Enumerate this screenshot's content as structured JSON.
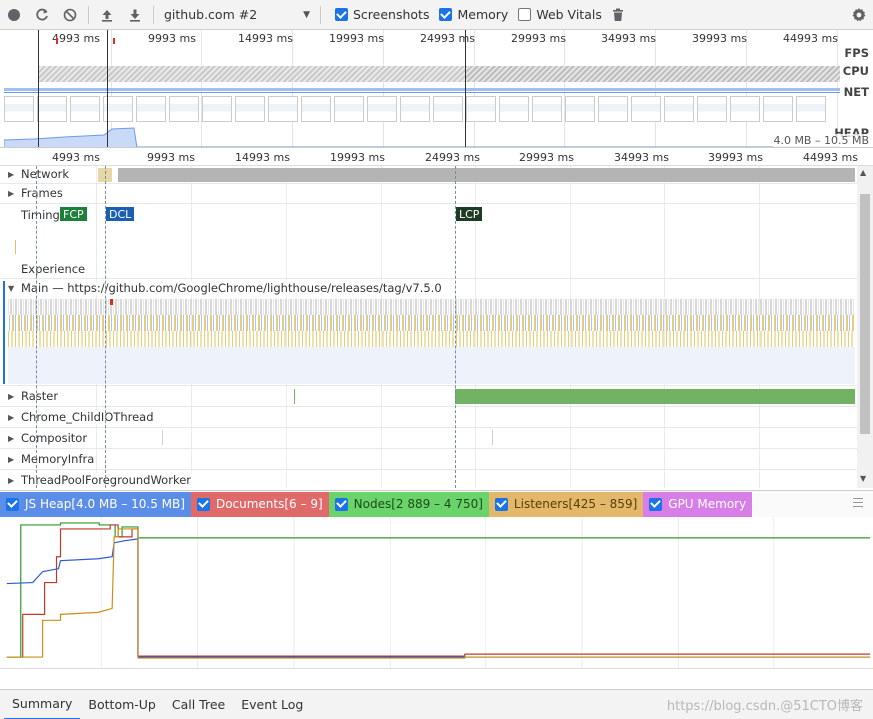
{
  "toolbar": {
    "recording": "github.com #2",
    "screenshots_label": "Screenshots",
    "memory_label": "Memory",
    "webvitals_label": "Web Vitals",
    "screenshots_checked": true,
    "memory_checked": true,
    "webvitals_checked": false
  },
  "overview": {
    "ticks": [
      "4993 ms",
      "9993 ms",
      "14993 ms",
      "19993 ms",
      "24993 ms",
      "29993 ms",
      "34993 ms",
      "39993 ms",
      "44993 ms"
    ],
    "labels": {
      "fps": "FPS",
      "cpu": "CPU",
      "net": "NET",
      "heap": "HEAP"
    },
    "heap_range": "4.0 MB – 10.5 MB"
  },
  "ruler": {
    "ticks": [
      "4993 ms",
      "9993 ms",
      "14993 ms",
      "19993 ms",
      "24993 ms",
      "29993 ms",
      "34993 ms",
      "39993 ms",
      "44993 ms"
    ]
  },
  "tracks": {
    "network": "Network",
    "frames": "Frames",
    "timings": "Timings",
    "experience": "Experience",
    "main": "Main — https://github.com/GoogleChrome/lighthouse/releases/tag/v7.5.0",
    "raster": "Raster",
    "childio": "Chrome_ChildIOThread",
    "compositor": "Compositor",
    "memoryinfra": "MemoryInfra",
    "threadpool": "ThreadPoolForegroundWorker"
  },
  "timings": {
    "fcp": "FCP",
    "dcl": "DCL",
    "lcp": "LCP"
  },
  "colors": {
    "fcp": "#1e7f3a",
    "dcl": "#1a5fb4",
    "lcp": "#1d3b25",
    "raster": "#72b263",
    "js_heap": "#2a5ad8",
    "documents": "#c0392b",
    "nodes": "#2e9a2e",
    "listeners": "#c9901a",
    "gpu": "#a43ac8"
  },
  "counters": [
    {
      "label": "JS Heap[4.0 MB – 10.5 MB]",
      "bg": "#5b8ee8",
      "fg": "#ffffff"
    },
    {
      "label": "Documents[6 – 9]",
      "bg": "#e06a6a",
      "fg": "#ffffff"
    },
    {
      "label": "Nodes[2 889 – 4 750]",
      "bg": "#6ad46a",
      "fg": "#1b4d1b"
    },
    {
      "label": "Listeners[425 – 859]",
      "bg": "#e3b86a",
      "fg": "#5a3d05"
    },
    {
      "label": "GPU Memory",
      "bg": "#d77ee8",
      "fg": "#ffffff"
    }
  ],
  "bottom_tabs": [
    "Summary",
    "Bottom-Up",
    "Call Tree",
    "Event Log"
  ],
  "watermark": "https://blog.csdn.@51CTO博客"
}
